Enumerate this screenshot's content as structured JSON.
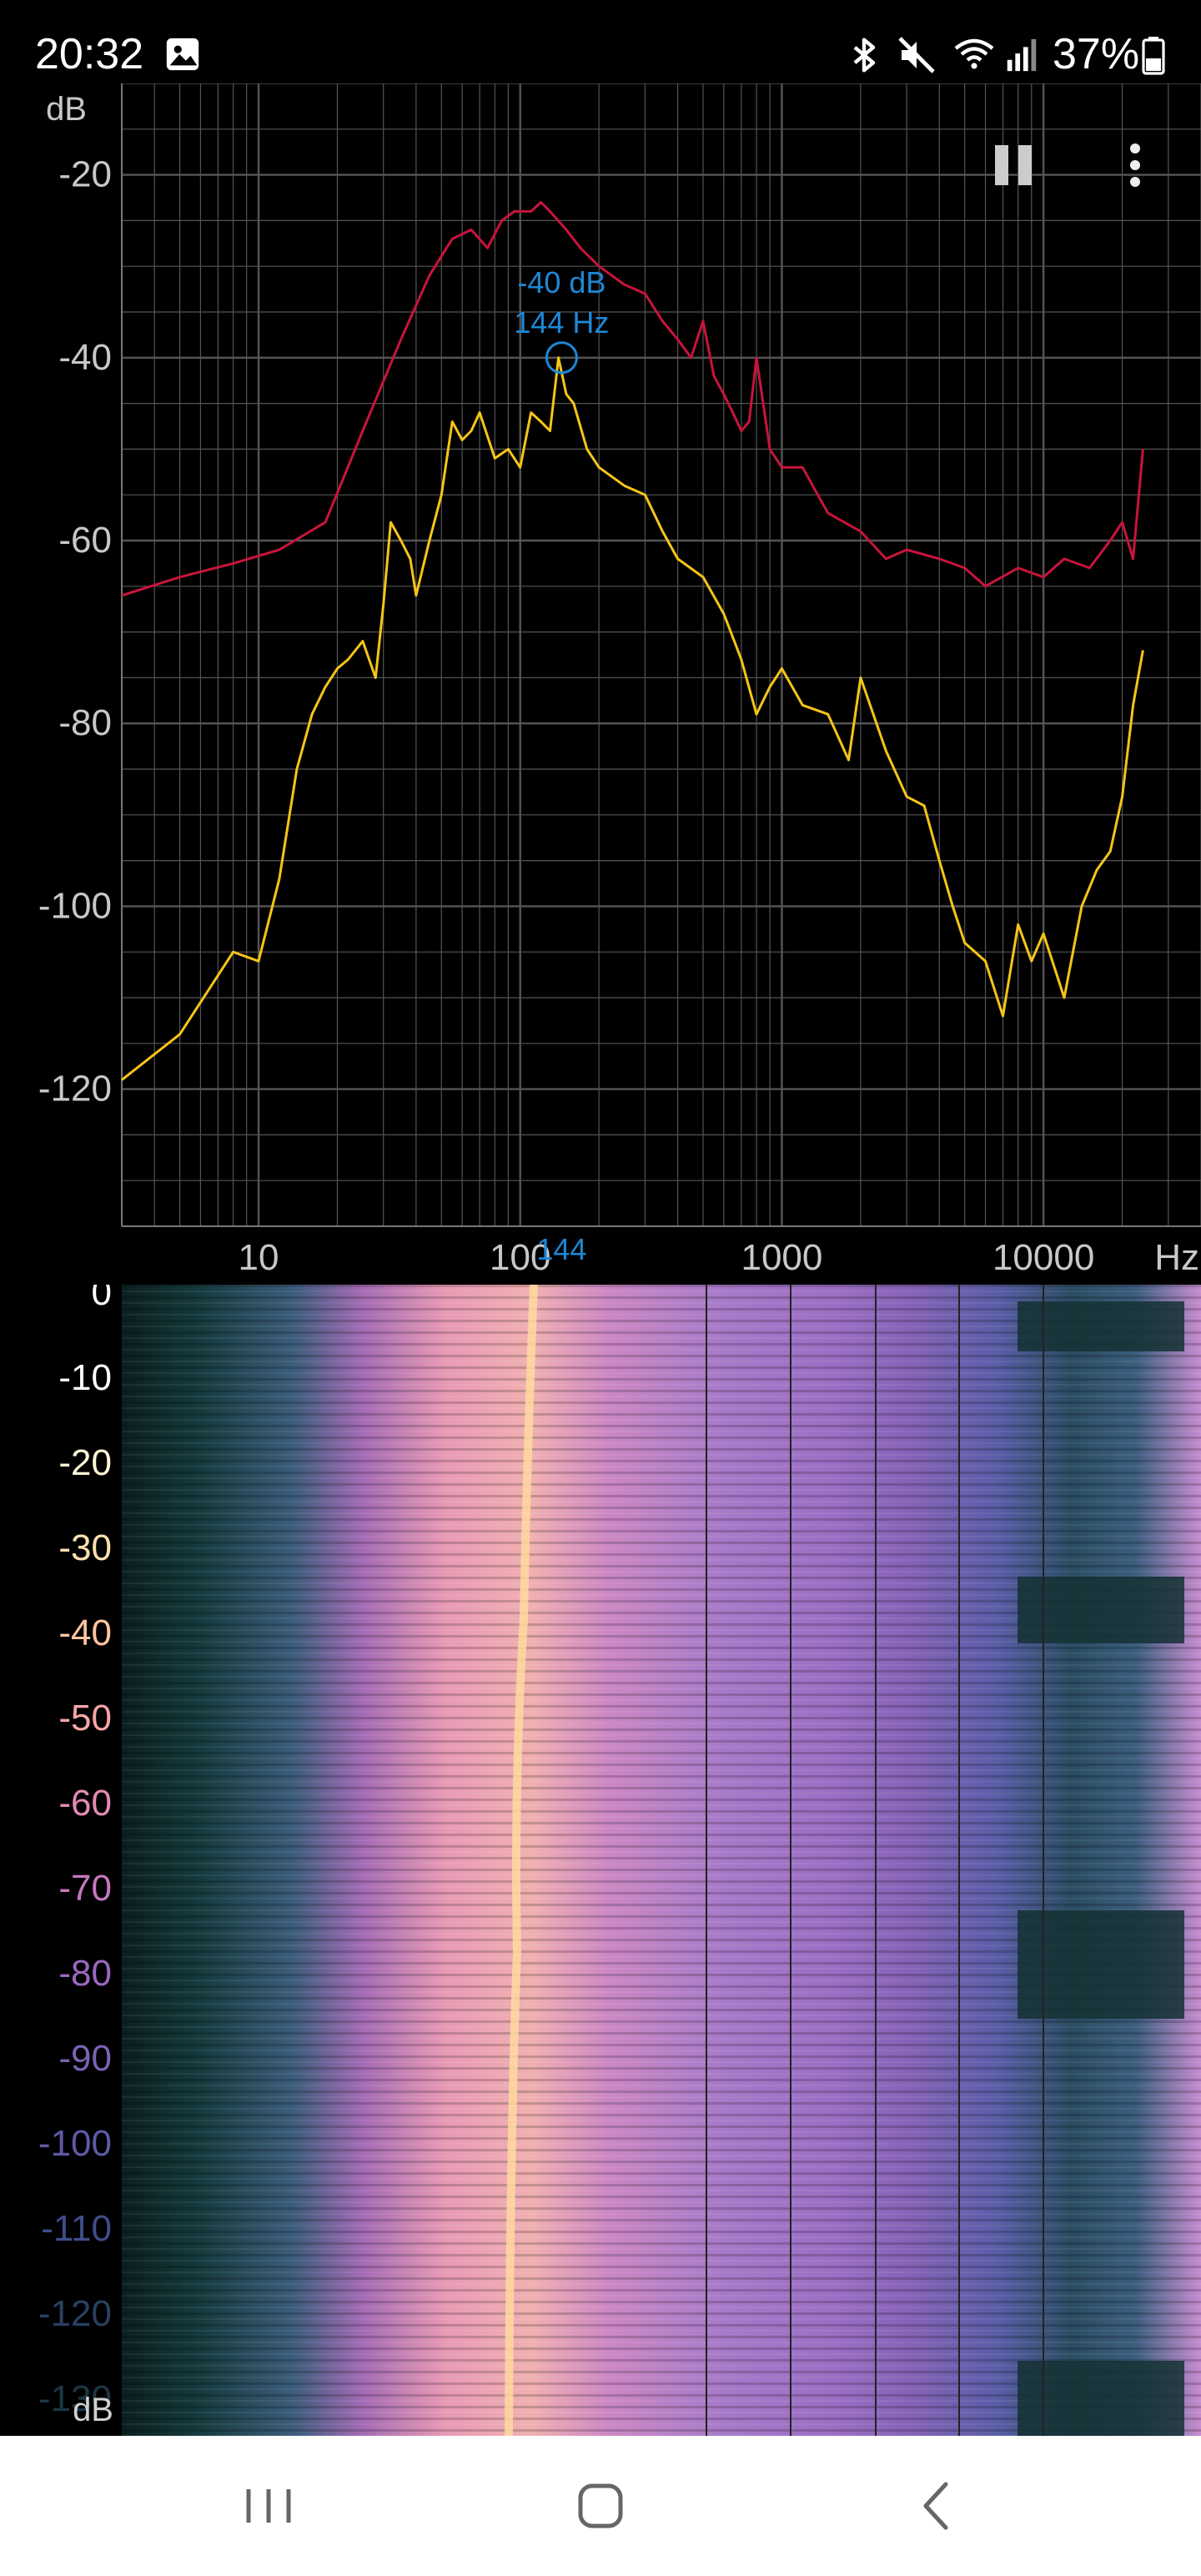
{
  "status_bar": {
    "time": "20:32",
    "battery_percent": "37%",
    "icons": [
      "gallery-icon",
      "bluetooth-icon",
      "mute-icon",
      "wifi-icon",
      "signal-icon",
      "battery-icon"
    ]
  },
  "toolbar": {
    "pause_icon": "pause-icon",
    "menu_icon": "more-vert-icon"
  },
  "spectrum": {
    "y_unit": "dB",
    "y_ticks": [
      "-20",
      "-40",
      "-60",
      "-80",
      "-100",
      "-120"
    ],
    "x_ticks": [
      "10",
      "100",
      "1000",
      "10000"
    ],
    "x_unit": "Hz",
    "cursor": {
      "db_label": "-40 dB",
      "hz_label": "144 Hz",
      "axis_marker": "144"
    },
    "colors": {
      "peak_hold": "#c8143c",
      "live": "#f5c518",
      "cursor": "#1e88d6",
      "grid": "#555555"
    }
  },
  "spectrogram": {
    "y_unit": "dB",
    "y_ticks": [
      "0",
      "-10",
      "-20",
      "-30",
      "-40",
      "-50",
      "-60",
      "-70",
      "-80",
      "-90",
      "-100",
      "-110",
      "-120",
      "-130"
    ],
    "y_tick_colors": [
      "#ffffff",
      "#ffffff",
      "#fff6d6",
      "#ffe0b0",
      "#ffc4a0",
      "#f5a6a6",
      "#e48bb4",
      "#c678c0",
      "#9a69c0",
      "#7a62b4",
      "#5d5aa6",
      "#3f4e8a",
      "#294062",
      "#1b3645"
    ]
  },
  "nav_bar": {
    "recent_icon": "recent-apps-icon",
    "home_icon": "home-icon",
    "back_icon": "back-icon"
  },
  "chart_data": {
    "type": "line",
    "x_scale": "log",
    "xlim": [
      3,
      40000
    ],
    "ylim": [
      -135,
      -10
    ],
    "xlabel": "Hz",
    "ylabel": "dB",
    "grid": true,
    "series": [
      {
        "color": "#c8143c",
        "x": [
          3,
          5,
          8,
          12,
          18,
          25,
          35,
          45,
          55,
          65,
          75,
          85,
          95,
          110,
          120,
          130,
          150,
          170,
          200,
          250,
          300,
          350,
          400,
          450,
          500,
          550,
          600,
          650,
          700,
          750,
          800,
          900,
          1000,
          1200,
          1500,
          2000,
          2500,
          3000,
          4000,
          5000,
          6000,
          8000,
          10000,
          12000,
          15000,
          18000,
          20000,
          22000,
          24000
        ],
        "y": [
          -66,
          -64,
          -62.5,
          -61,
          -58,
          -48,
          -38,
          -31,
          -27,
          -26,
          -28,
          -25,
          -24,
          -24,
          -23,
          -24,
          -26,
          -28,
          -30,
          -32,
          -33,
          -36,
          -38,
          -40,
          -36,
          -42,
          -44,
          -46,
          -48,
          -47,
          -40,
          -50,
          -52,
          -52,
          -57,
          -59,
          -62,
          -61,
          -62,
          -63,
          -65,
          -63,
          -64,
          -62,
          -63,
          -60,
          -58,
          -62,
          -50
        ]
      },
      {
        "color": "#f5c518",
        "x": [
          3,
          5,
          8,
          10,
          12,
          14,
          16,
          18,
          20,
          22,
          25,
          28,
          30,
          32,
          35,
          38,
          40,
          45,
          50,
          55,
          60,
          65,
          70,
          80,
          90,
          100,
          110,
          120,
          130,
          140,
          150,
          160,
          180,
          200,
          250,
          300,
          350,
          400,
          500,
          600,
          700,
          800,
          900,
          1000,
          1200,
          1500,
          1800,
          2000,
          2500,
          3000,
          3500,
          4000,
          4500,
          5000,
          6000,
          7000,
          8000,
          9000,
          10000,
          12000,
          14000,
          16000,
          18000,
          20000,
          22000,
          24000
        ],
        "y": [
          -119,
          -114,
          -105,
          -106,
          -97,
          -85,
          -79,
          -76,
          -74,
          -73,
          -71,
          -75,
          -67,
          -58,
          -60,
          -62,
          -66,
          -60,
          -55,
          -47,
          -49,
          -48,
          -46,
          -51,
          -50,
          -52,
          -46,
          -47,
          -48,
          -40,
          -44,
          -45,
          -50,
          -52,
          -54,
          -55,
          -59,
          -62,
          -64,
          -68,
          -73,
          -79,
          -76,
          -74,
          -78,
          -79,
          -84,
          -75,
          -83,
          -88,
          -89,
          -95,
          -100,
          -104,
          -106,
          -112,
          -102,
          -106,
          -103,
          -110,
          -100,
          -96,
          -94,
          -88,
          -78,
          -72
        ]
      }
    ],
    "annotations": [
      {
        "x": 144,
        "y": -40,
        "text": "-40 dB 144 Hz"
      }
    ]
  }
}
